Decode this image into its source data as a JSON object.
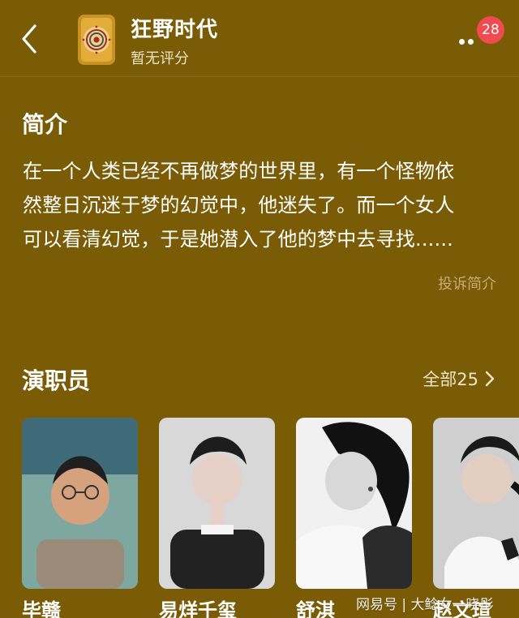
{
  "colors": {
    "background": "#7a5b06",
    "text_primary": "#ffffff",
    "text_secondary": "#efe3c7",
    "muted_link": "#c7ae75",
    "badge": "#ef4b50"
  },
  "header": {
    "title": "狂野时代",
    "subtitle": "暂无评分",
    "badge_count": "28",
    "back_icon": "back-arrow-icon",
    "more_icon": "more-dots-icon"
  },
  "intro": {
    "heading": "简介",
    "lines": [
      "在一个人类已经不再做梦的世界里，有一个怪物依",
      "然整日沉迷于梦的幻觉中，他迷失了。而一个女人",
      "可以看清幻觉，于是她潜入了他的梦中去寻找......"
    ],
    "report_label": "投诉简介"
  },
  "cast": {
    "heading": "演职员",
    "all_label": "全部25",
    "chevron_icon": "chevron-right-icon",
    "members": [
      {
        "name": "毕赣"
      },
      {
        "name": "易烊千玺"
      },
      {
        "name": "舒淇"
      },
      {
        "name": "赵文瑄"
      }
    ]
  },
  "watermark": "网易号 | 大鲶女一晓彤"
}
